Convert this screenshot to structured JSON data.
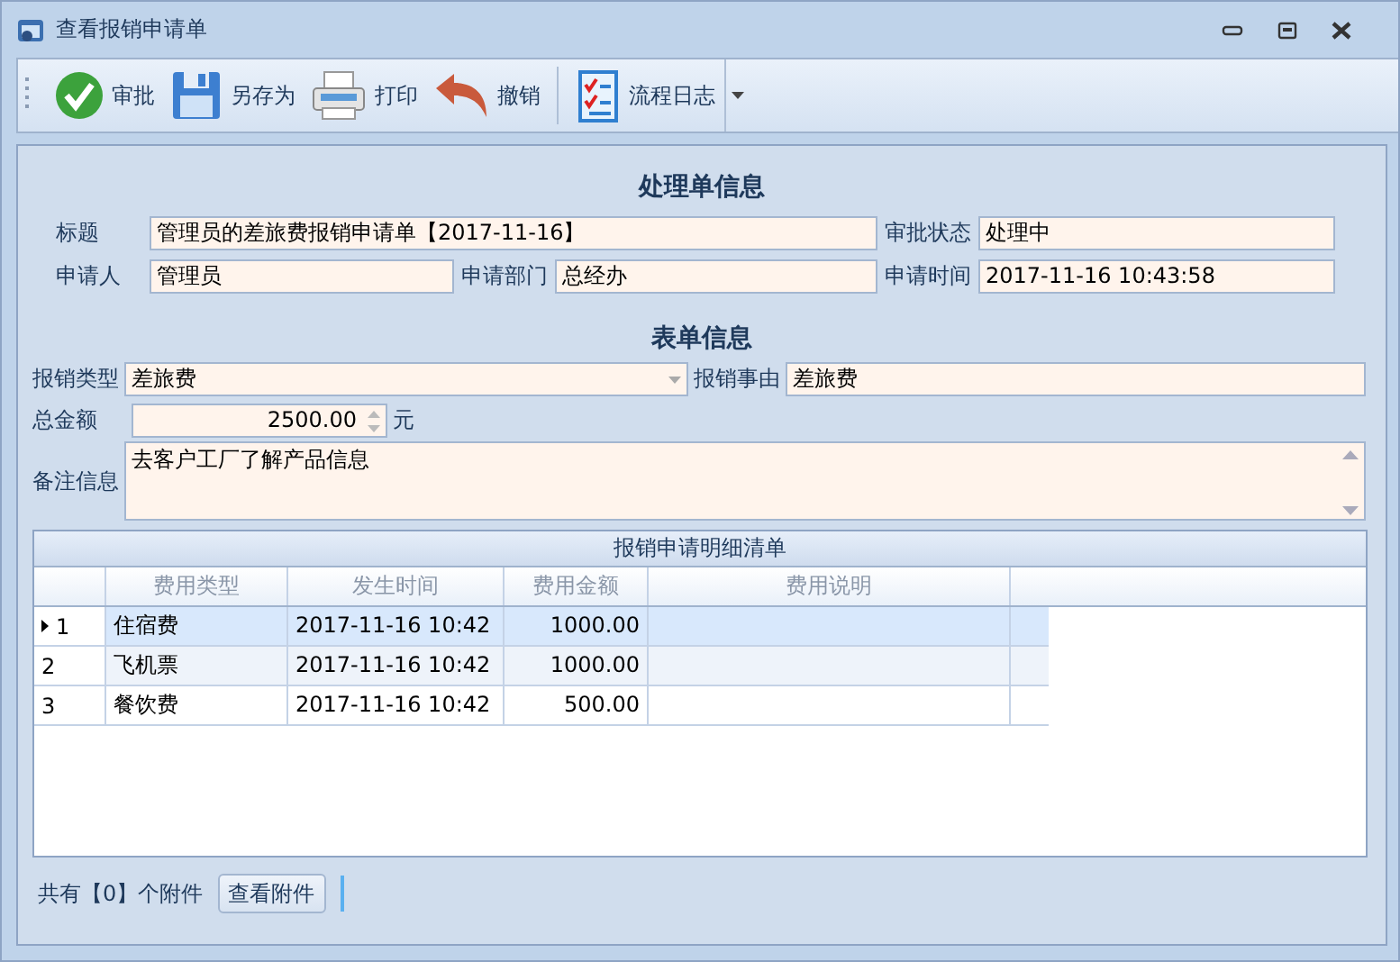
{
  "window": {
    "title": "查看报销申请单"
  },
  "toolbar": [
    {
      "kind": "approve",
      "label": "审批"
    },
    {
      "kind": "save",
      "label": "另存为"
    },
    {
      "kind": "print",
      "label": "打印"
    },
    {
      "kind": "undo",
      "label": "撤销"
    },
    {
      "kind": "log",
      "label": "流程日志"
    }
  ],
  "process_section": {
    "heading": "处理单信息",
    "title_label": "标题",
    "title": "管理员的差旅费报销申请单【2017-11-16】",
    "status_label": "审批状态",
    "status": "处理中",
    "applicant_label": "申请人",
    "applicant": "管理员",
    "department_label": "申请部门",
    "department": "总经办",
    "time_label": "申请时间",
    "time": "2017-11-16 10:43:58"
  },
  "form_section": {
    "heading": "表单信息",
    "type_label": "报销类型",
    "type": "差旅费",
    "reason_label": "报销事由",
    "reason": "差旅费",
    "total_label": "总金额",
    "total": "2500.00",
    "unit": "元",
    "note_label": "备注信息",
    "note": "去客户工厂了解产品信息"
  },
  "table": {
    "caption": "报销申请明细清单",
    "columns": [
      "费用类型",
      "发生时间",
      "费用金额",
      "费用说明"
    ],
    "rows": [
      {
        "index": "1",
        "selected": true,
        "cells": [
          "住宿费",
          "2017-11-16 10:42",
          "1000.00",
          ""
        ]
      },
      {
        "index": "2",
        "selected": false,
        "cells": [
          "飞机票",
          "2017-11-16 10:42",
          "1000.00",
          ""
        ]
      },
      {
        "index": "3",
        "selected": false,
        "cells": [
          "餐饮费",
          "2017-11-16 10:42",
          "500.00",
          ""
        ]
      }
    ]
  },
  "footer": {
    "attachments": "共有【0】个附件",
    "view_button": "查看附件"
  }
}
